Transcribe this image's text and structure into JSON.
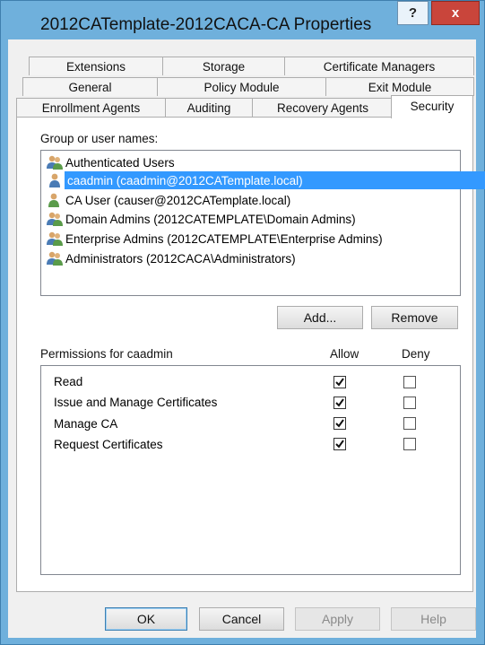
{
  "window": {
    "title": "2012CATemplate-2012CACA-CA Properties",
    "help_label": "?",
    "close_label": "x"
  },
  "tabs": {
    "row1": [
      "Extensions",
      "Storage",
      "Certificate Managers"
    ],
    "row2": [
      "General",
      "Policy Module",
      "Exit Module"
    ],
    "row3": [
      "Enrollment Agents",
      "Auditing",
      "Recovery Agents",
      "Security"
    ],
    "active": "Security"
  },
  "security": {
    "group_label": "Group or user names:",
    "users": [
      {
        "label": "Authenticated Users",
        "icon": "group-icon"
      },
      {
        "label": "caadmin (caadmin@2012CATemplate.local)",
        "icon": "user-icon",
        "selected": true
      },
      {
        "label": "CA User (causer@2012CATemplate.local)",
        "icon": "user-icon"
      },
      {
        "label": "Domain Admins (2012CATEMPLATE\\Domain Admins)",
        "icon": "group-icon"
      },
      {
        "label": "Enterprise Admins (2012CATEMPLATE\\Enterprise Admins)",
        "icon": "group-icon"
      },
      {
        "label": "Administrators (2012CACA\\Administrators)",
        "icon": "group-icon"
      }
    ],
    "add_label": "Add...",
    "remove_label": "Remove",
    "permissions_label": "Permissions for caadmin",
    "allow_label": "Allow",
    "deny_label": "Deny",
    "permissions": [
      {
        "label": "Read",
        "allow": true,
        "deny": false
      },
      {
        "label": "Issue and Manage Certificates",
        "allow": true,
        "deny": false
      },
      {
        "label": "Manage CA",
        "allow": true,
        "deny": false
      },
      {
        "label": "Request Certificates",
        "allow": true,
        "deny": false
      }
    ]
  },
  "footer": {
    "ok_label": "OK",
    "cancel_label": "Cancel",
    "apply_label": "Apply",
    "help_label": "Help"
  }
}
